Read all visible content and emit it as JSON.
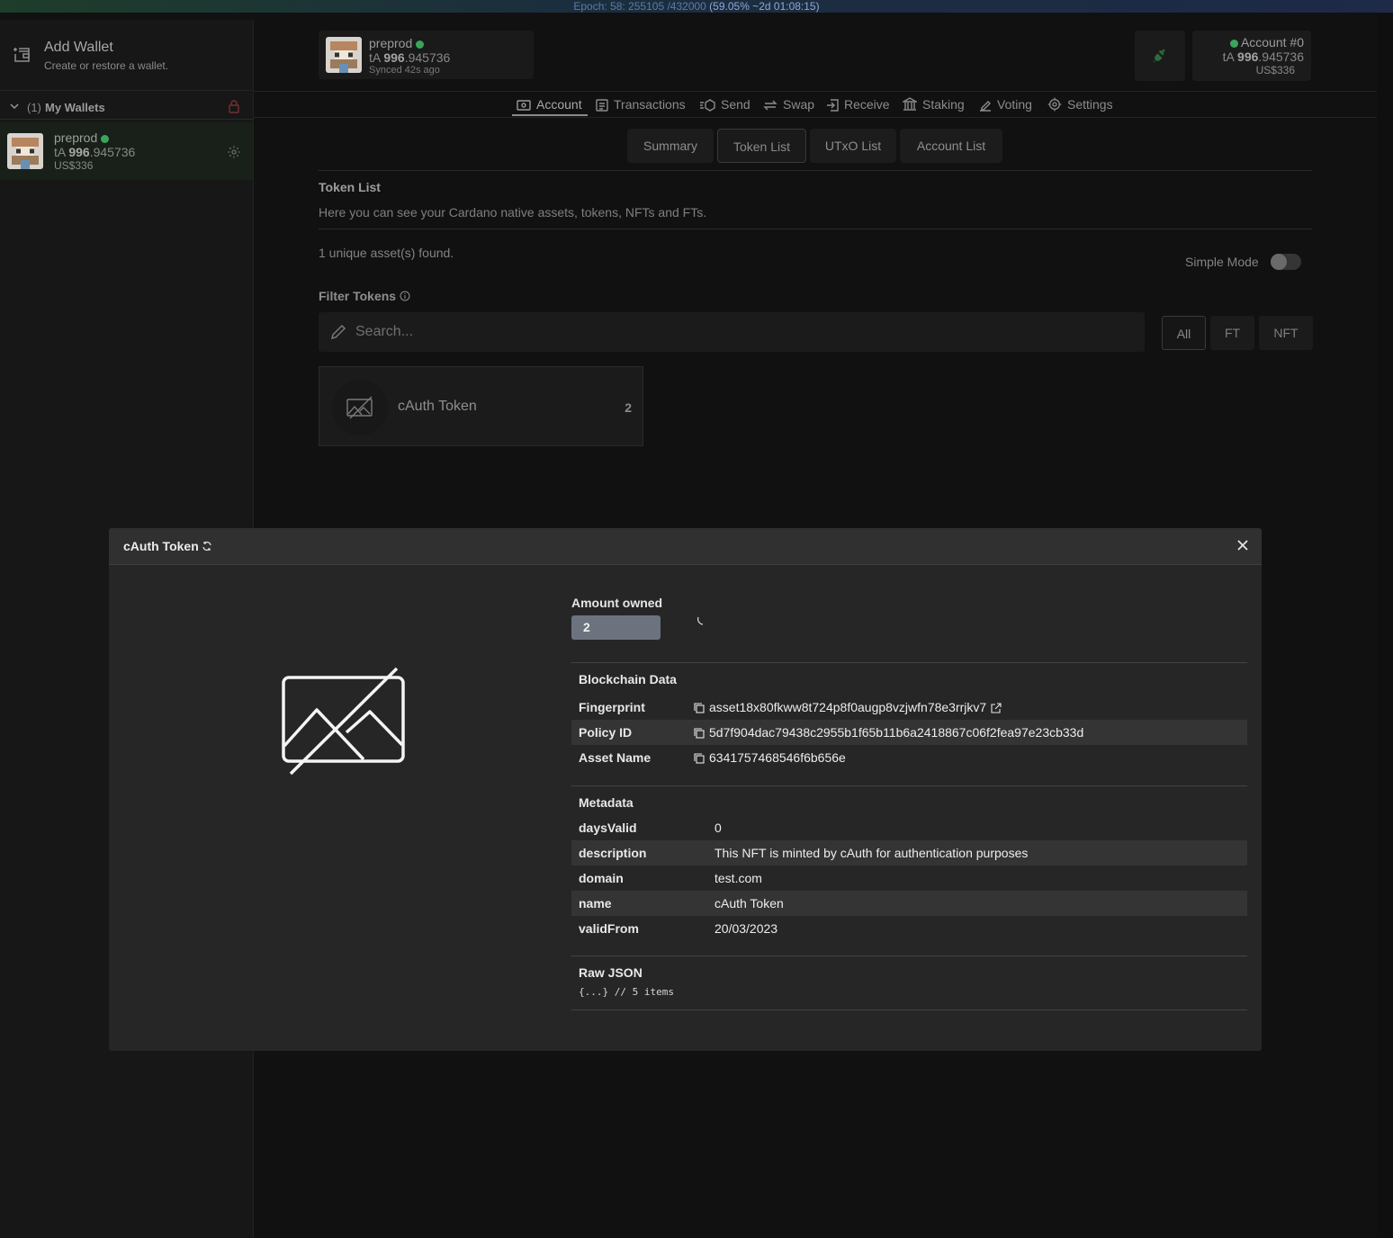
{
  "epoch": {
    "prefix": "Epoch: 58: 255105 /432000 ",
    "highlight": "(59.05% ~2d 01:08:15)"
  },
  "sidebar": {
    "add_wallet": {
      "title": "Add Wallet",
      "subtitle": "Create or restore a wallet."
    },
    "wallets_count": "(1)",
    "wallets_label": "My Wallets",
    "wallet": {
      "name": "preprod",
      "ticker": "tA",
      "balance_int": "996",
      "balance_dec": ".945736",
      "usd": "US$336"
    }
  },
  "header": {
    "wallet": {
      "name": "preprod",
      "ticker": "tA",
      "balance_int": "996",
      "balance_dec": ".945736",
      "synced": "Synced 42s ago"
    },
    "account": {
      "name": "Account #0",
      "ticker": "tA",
      "balance_int": "996",
      "balance_dec": ".945736",
      "usd": "US$336"
    }
  },
  "nav": {
    "items": [
      "Account",
      "Transactions",
      "Send",
      "Swap",
      "Receive",
      "Staking",
      "Voting",
      "Settings"
    ],
    "active": "Account"
  },
  "subtabs": [
    "Summary",
    "Token List",
    "UTxO List",
    "Account List"
  ],
  "token_list": {
    "title": "Token List",
    "description": "Here you can see your Cardano native assets, tokens, NFTs and FTs.",
    "found": "1 unique asset(s) found.",
    "simple_mode": "Simple Mode",
    "filter_label": "Filter Tokens",
    "search_placeholder": "Search...",
    "filters": [
      "All",
      "FT",
      "NFT"
    ],
    "tokens": [
      {
        "name": "cAuth Token",
        "count": "2"
      }
    ]
  },
  "modal": {
    "title": "cAuth Token",
    "amount_label": "Amount owned",
    "amount": "2",
    "blockchain_title": "Blockchain Data",
    "blockchain": [
      {
        "key": "Fingerprint",
        "value": "asset18x80fkww8t724p8f0augp8vzjwfn78e3rrjkv7"
      },
      {
        "key": "Policy ID",
        "value": "5d7f904dac79438c2955b1f65b11b6a2418867c06f2fea97e23cb33d"
      },
      {
        "key": "Asset Name",
        "value": "6341757468546f6b656e"
      }
    ],
    "metadata_title": "Metadata",
    "metadata": [
      {
        "key": "daysValid",
        "value": "0"
      },
      {
        "key": "description",
        "value": "This NFT is minted by cAuth for authentication purposes"
      },
      {
        "key": "domain",
        "value": "test.com"
      },
      {
        "key": "name",
        "value": "cAuth Token"
      },
      {
        "key": "validFrom",
        "value": "20/03/2023"
      }
    ],
    "raw_title": "Raw JSON",
    "raw_value": "{...} // 5 items"
  }
}
